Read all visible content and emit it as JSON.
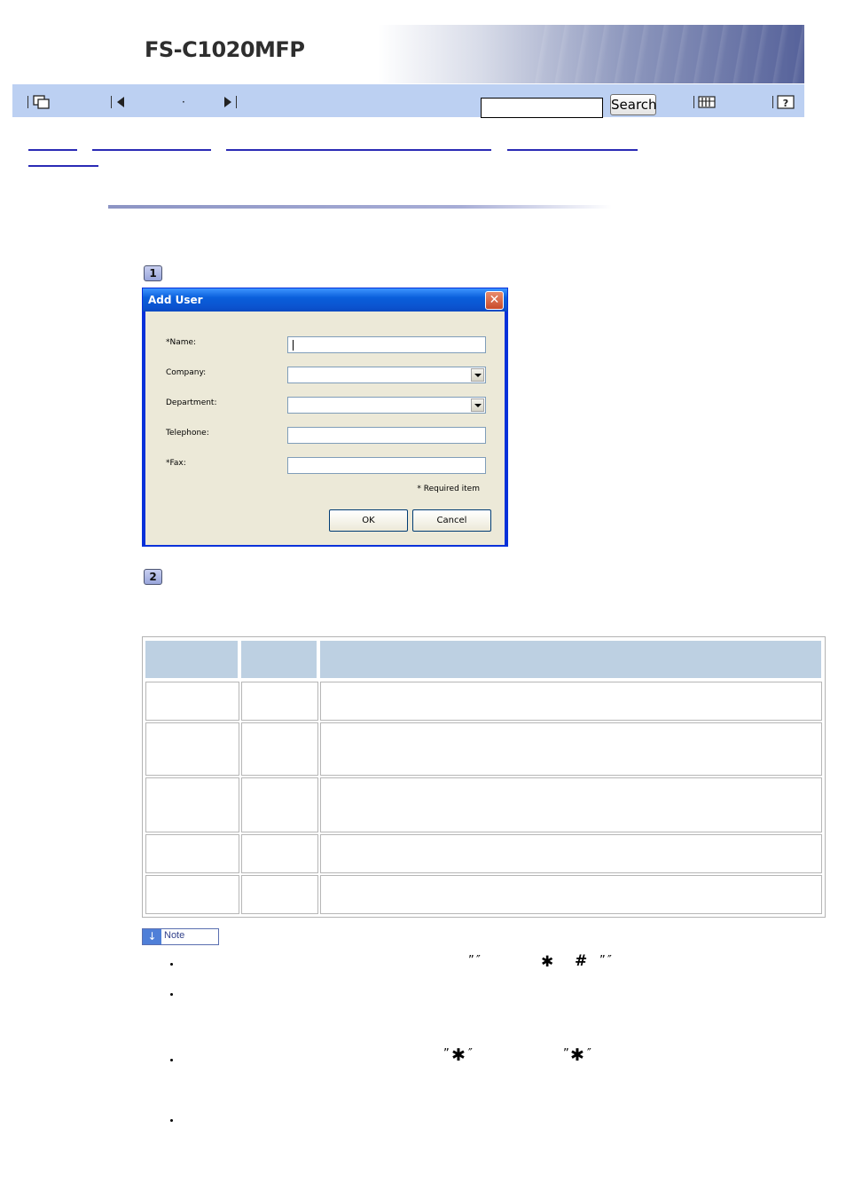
{
  "header": {
    "product_title": "FS-C1020MFP"
  },
  "toolbar": {
    "icons": [
      "contents-icon",
      "previous-page-icon",
      "next-page-icon",
      "index-icon",
      "help-icon"
    ],
    "page_dot": "·",
    "search_value": "",
    "search_label": "Search"
  },
  "step1": {
    "number": "1"
  },
  "step2": {
    "number": "2"
  },
  "dialog": {
    "title": "Add User",
    "close_symbol": "✕",
    "fields": [
      {
        "label": "*Name:",
        "type": "text",
        "value": ""
      },
      {
        "label": "Company:",
        "type": "dropdown",
        "value": ""
      },
      {
        "label": "Department:",
        "type": "dropdown",
        "value": ""
      },
      {
        "label": "Telephone:",
        "type": "text",
        "value": ""
      },
      {
        "label": "*Fax:",
        "type": "text",
        "value": ""
      }
    ],
    "required_note": "* Required item",
    "ok_label": "OK",
    "cancel_label": "Cancel"
  },
  "note": {
    "badge_label": "Note",
    "glyphs": {
      "quote_open": "”",
      "quote_close": "″",
      "asterisk": "✱",
      "hash": "#"
    }
  }
}
